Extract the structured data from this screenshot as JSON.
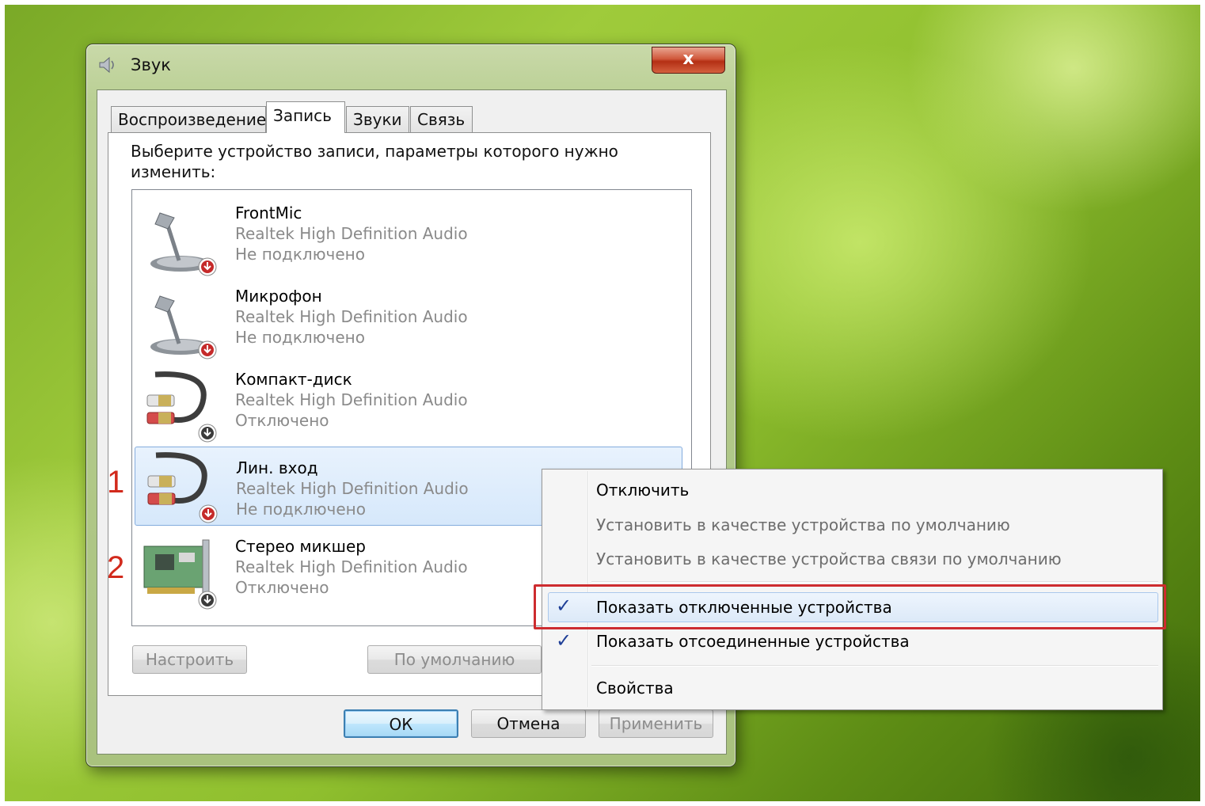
{
  "window": {
    "title": "Звук",
    "close_label": "x"
  },
  "tabs": [
    {
      "label": "Воспроизведение"
    },
    {
      "label": "Запись"
    },
    {
      "label": "Звуки"
    },
    {
      "label": "Связь"
    }
  ],
  "active_tab": "Запись",
  "instruction": "Выберите устройство записи, параметры которого нужно изменить:",
  "devices": [
    {
      "name": "FrontMic",
      "driver": "Realtek High Definition Audio",
      "status": "Не подключено",
      "icon": "microphone-icon"
    },
    {
      "name": "Микрофон",
      "driver": "Realtek High Definition Audio",
      "status": "Не подключено",
      "icon": "microphone-icon"
    },
    {
      "name": "Компакт-диск",
      "driver": "Realtek High Definition Audio",
      "status": "Отключено",
      "icon": "rca-cable-icon"
    },
    {
      "name": "Лин. вход",
      "driver": "Realtek High Definition Audio",
      "status": "Не подключено",
      "icon": "rca-cable-icon"
    },
    {
      "name": "Стерео микшер",
      "driver": "Realtek High Definition Audio",
      "status": "Отключено",
      "icon": "sound-card-icon"
    }
  ],
  "selected_device": "Лин. вход",
  "panel_buttons": {
    "configure": "Настроить",
    "default": "По умолчанию"
  },
  "dialog_buttons": {
    "ok": "ОК",
    "cancel": "Отмена",
    "apply": "Применить"
  },
  "annotations": {
    "marker1": "1",
    "marker2": "2"
  },
  "context_menu": {
    "items": [
      {
        "label": "Отключить",
        "enabled": true,
        "checked": false
      },
      {
        "label": "Установить в качестве устройства по умолчанию",
        "enabled": false,
        "checked": false
      },
      {
        "label": "Установить в качестве устройства связи по умолчанию",
        "enabled": false,
        "checked": false
      },
      {
        "label": "Показать отключенные устройства",
        "enabled": true,
        "checked": true
      },
      {
        "label": "Показать отсоединенные устройства",
        "enabled": true,
        "checked": true
      },
      {
        "label": "Свойства",
        "enabled": true,
        "checked": false
      }
    ],
    "check_glyph": "✓",
    "highlight_color": "#cd2c2f"
  }
}
